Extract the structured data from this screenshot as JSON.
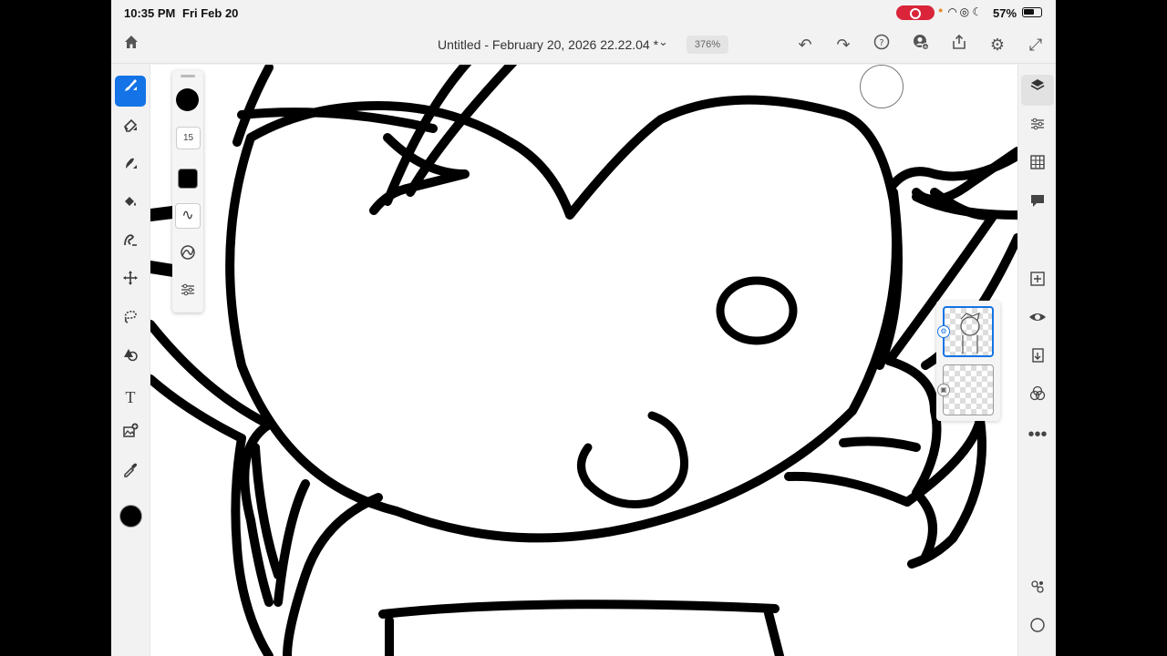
{
  "status_bar": {
    "time": "10:35 PM",
    "date": "Fri Feb 20",
    "battery": "57%"
  },
  "header": {
    "title": "Untitled - February 20, 2026 22.22.04 *",
    "zoom": "376%"
  },
  "brush_panel": {
    "size": "15"
  },
  "colors": {
    "accent": "#1473e6",
    "record": "#d9243a",
    "current_color": "#000000"
  },
  "left_tools": [
    "brush-icon",
    "eraser-icon",
    "smudge-icon",
    "fill-icon",
    "liquify-icon",
    "move-icon",
    "lasso-icon",
    "shape-icon",
    "text-icon",
    "place-image-icon",
    "eyedropper-icon"
  ],
  "right_tools": [
    "layers-icon",
    "layer-properties-icon",
    "grid-icon",
    "comments-icon",
    "add-layer-icon",
    "visibility-icon",
    "merge-down-icon",
    "blend-icon",
    "more-icon"
  ]
}
